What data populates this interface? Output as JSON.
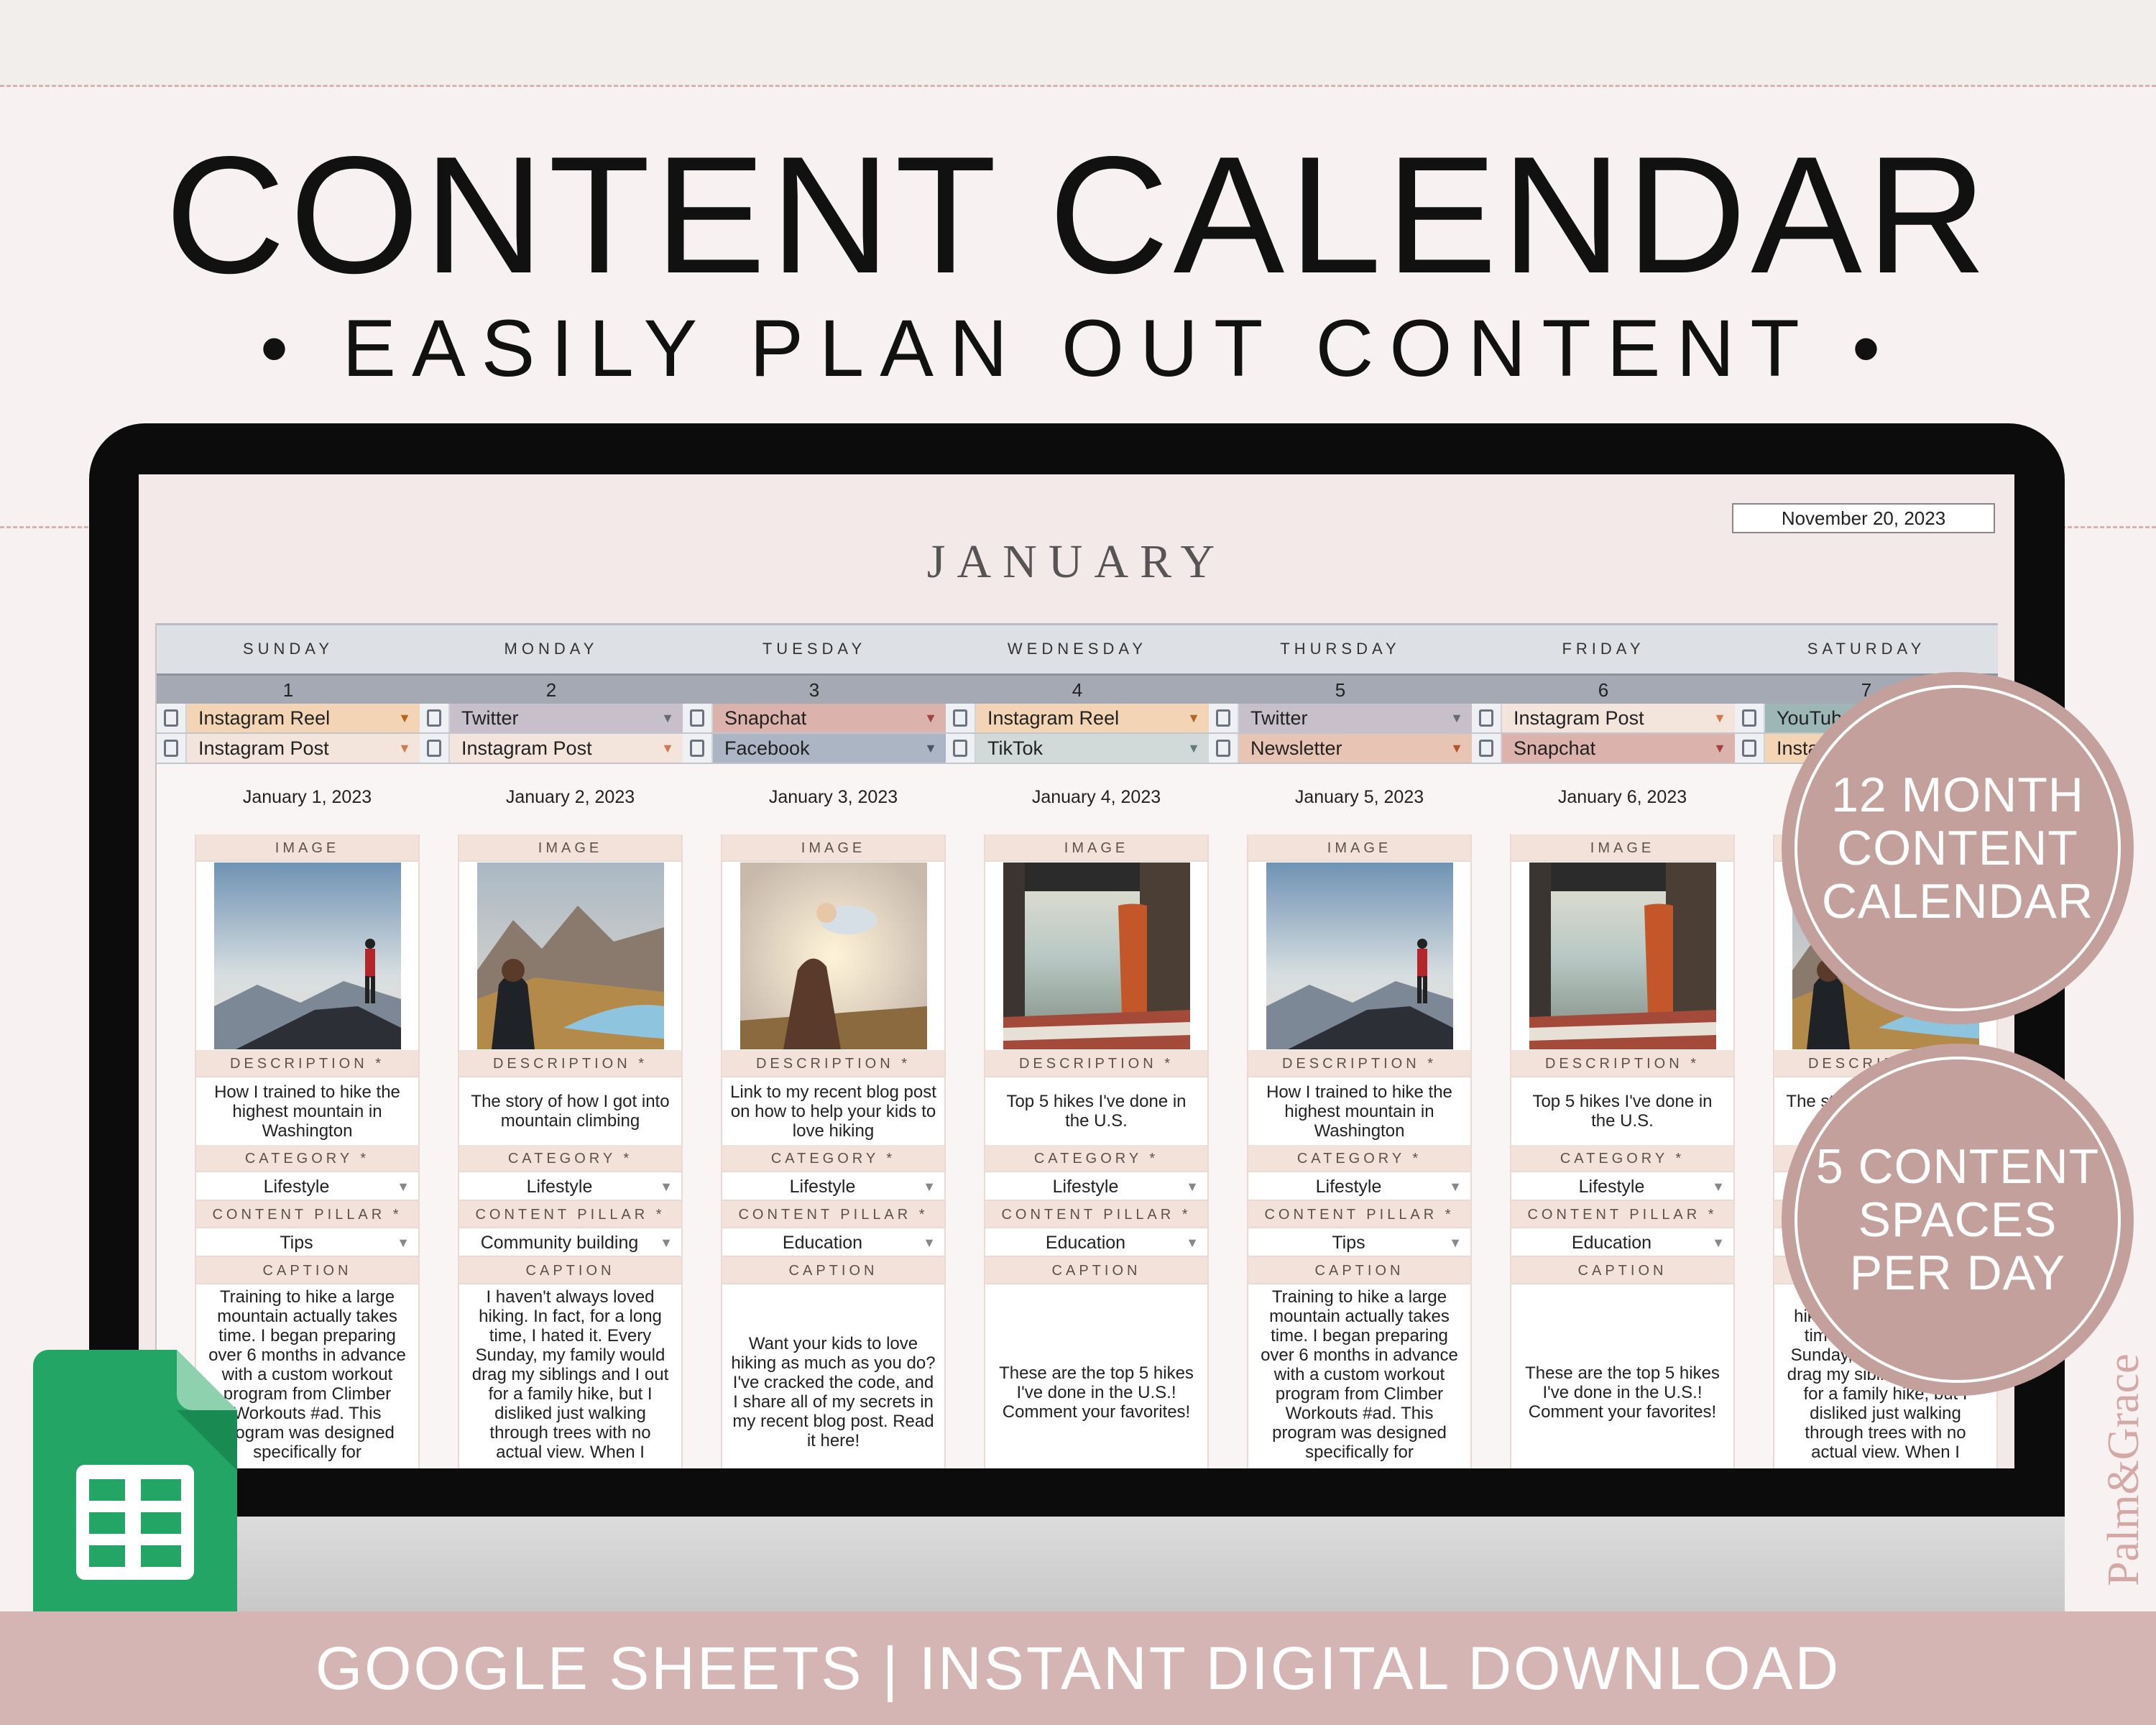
{
  "hero": {
    "title": "CONTENT CALENDAR",
    "subtitle": "• EASILY PLAN OUT CONTENT •",
    "footer": "GOOGLE SHEETS | INSTANT DIGITAL DOWNLOAD",
    "badge_1": "12 MONTH CONTENT CALENDAR",
    "badge_2": "5 CONTENT SPACES PER DAY",
    "watermark": "Palm&Grace",
    "colors": {
      "accent": "#c4a09d",
      "band": "#d4b5b3",
      "sheets_green": "#1e8e4f"
    }
  },
  "sheet": {
    "month": "JANUARY",
    "today": "November 20, 2023",
    "labels": {
      "image": "IMAGE",
      "description": "DESCRIPTION *",
      "category": "CATEGORY *",
      "pillar": "CONTENT PILLAR *",
      "caption": "CAPTION"
    },
    "platform_colors": {
      "Instagram Reel": "#f3d5b5",
      "Twitter": "#c7bfca",
      "Snapchat": "#dbb2ac",
      "Instagram Post": "#f3e4dc",
      "Facebook": "#abb5c4",
      "TikTok": "#d1dad9",
      "Newsletter": "#e8c4b4",
      "YouTube": "#9db6b6"
    },
    "days": [
      {
        "weekday": "SUNDAY",
        "num": "1",
        "platforms": [
          "Instagram Reel",
          "Instagram Post"
        ],
        "date": "January 1, 2023",
        "image": "hiker-summit-photo",
        "description": "How I trained to hike the highest mountain in Washington",
        "category": "Lifestyle",
        "pillar": "Tips",
        "caption": "Training to hike a large mountain actually takes time. I began preparing over 6 months in advance with a custom workout program from Climber Workouts #ad. This program was designed specifically for"
      },
      {
        "weekday": "MONDAY",
        "num": "2",
        "platforms": [
          "Twitter",
          "Instagram Post"
        ],
        "date": "January 2, 2023",
        "image": "woman-mountain-lake-photo",
        "description": "The story of how I got into mountain climbing",
        "category": "Lifestyle",
        "pillar": "Community building",
        "caption": "I haven't always loved hiking. In fact, for a long time, I hated it. Every Sunday, my family would drag my siblings and I out for a family hike, but I disliked just walking through trees with no actual view. When I"
      },
      {
        "weekday": "TUESDAY",
        "num": "3",
        "platforms": [
          "Snapchat",
          "Facebook"
        ],
        "date": "January 3, 2023",
        "image": "parent-child-sunset-photo",
        "description": "Link to my recent blog post on how to help your kids to love hiking",
        "category": "Lifestyle",
        "pillar": "Education",
        "caption": "Want your kids to love hiking as much as you do? I've cracked the code, and I share all of my secrets in my recent blog post. Read it here!"
      },
      {
        "weekday": "WEDNESDAY",
        "num": "4",
        "platforms": [
          "Instagram Reel",
          "TikTok"
        ],
        "date": "January 4, 2023",
        "image": "beach-van-photo",
        "description": "Top 5 hikes I've done in the U.S.",
        "category": "Lifestyle",
        "pillar": "Education",
        "caption": "These are the top 5 hikes I've done in the U.S.! Comment your favorites!"
      },
      {
        "weekday": "THURSDAY",
        "num": "5",
        "platforms": [
          "Twitter",
          "Newsletter"
        ],
        "date": "January 5, 2023",
        "image": "hiker-summit-photo",
        "description": "How I trained to hike the highest mountain in Washington",
        "category": "Lifestyle",
        "pillar": "Tips",
        "caption": "Training to hike a large mountain actually takes time. I began preparing over 6 months in advance with a custom workout program from Climber Workouts #ad. This program was designed specifically for"
      },
      {
        "weekday": "FRIDAY",
        "num": "6",
        "platforms": [
          "Instagram Post",
          "Snapchat"
        ],
        "date": "January 6, 2023",
        "image": "beach-van-photo",
        "description": "Top 5 hikes I've done in the U.S.",
        "category": "Lifestyle",
        "pillar": "Education",
        "caption": "These are the top 5 hikes I've done in the U.S.! Comment your favorites!"
      },
      {
        "weekday": "SATURDAY",
        "num": "7",
        "platforms": [
          "YouTube",
          "Instagram Reel"
        ],
        "date": "",
        "image": "woman-mountain-lake-photo",
        "description": "The story of how I got into mountain climbing",
        "category": "",
        "pillar": "",
        "caption": "I haven't always loved hiking. In fact, for a long time, I hated it. Every Sunday, my family would drag my siblings and I out for a family hike, but I disliked just walking through trees with no actual view. When I"
      }
    ]
  }
}
